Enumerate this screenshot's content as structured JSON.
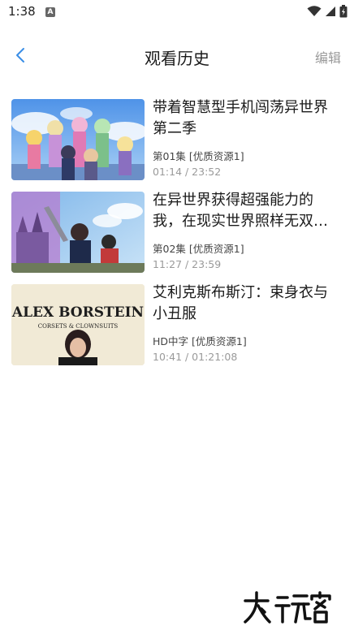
{
  "status_bar": {
    "time": "1:38",
    "app_icon": "A"
  },
  "header": {
    "title": "观看历史",
    "edit_label": "编辑",
    "back_icon": "chevron-left-icon"
  },
  "history": [
    {
      "title": "带着智慧型手机闯荡异世界第二季",
      "source": "第01集 [优质资源1]",
      "progress": "01:14 / 23:52"
    },
    {
      "title": "在异世界获得超强能力的我，在现实世界照样无双～等级提升改变人生命运～",
      "source": "第02集 [优质资源1]",
      "progress": "11:27 / 23:59"
    },
    {
      "title": "艾利克斯布斯汀：束身衣与小丑服",
      "source": "HD中字 [优质资源1]",
      "progress": "10:41 / 01:21:08",
      "thumb_text_1": "ALEX BORSTEIN",
      "thumb_text_2": "CORSETS & CLOWNSUITS"
    }
  ],
  "colors": {
    "accent": "#3a8ee6",
    "muted": "#9a9a9a"
  }
}
